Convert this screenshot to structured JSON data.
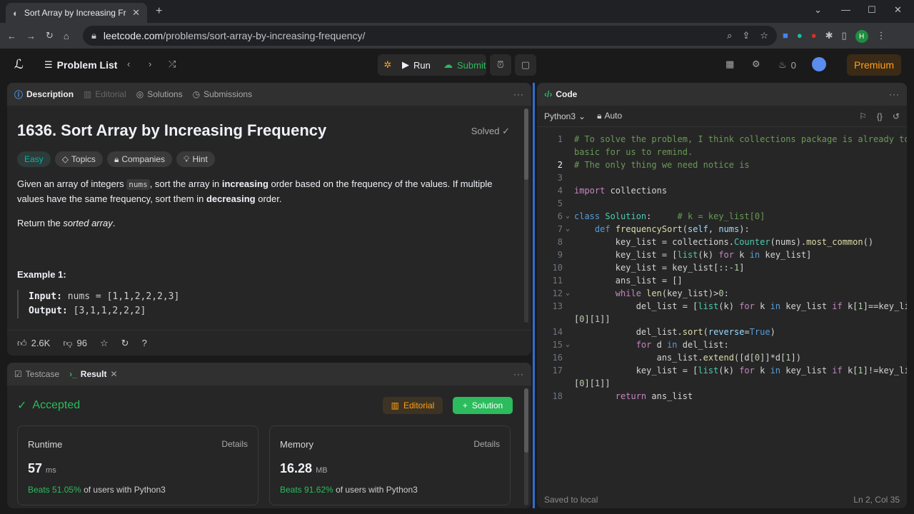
{
  "browser": {
    "tab_title": "Sort Array by Increasing Frequ...",
    "url_host": "leetcode.com",
    "url_path": "/problems/sort-array-by-increasing-frequency/",
    "profile_initial": "H"
  },
  "header": {
    "problem_list": "Problem List",
    "run": "Run",
    "submit": "Submit",
    "streak": "0",
    "premium": "Premium"
  },
  "description": {
    "tabs": [
      "Description",
      "Editorial",
      "Solutions",
      "Submissions"
    ],
    "title": "1636. Sort Array by Increasing Frequency",
    "status": "Solved",
    "tags": [
      "Easy",
      "Topics",
      "Companies",
      "Hint"
    ],
    "para1_a": "Given an array of integers ",
    "para1_code": "nums",
    "para1_b": ", sort the array in ",
    "para1_bold1": "increasing",
    "para1_c": " order based on the frequency of the values. If multiple values have the same frequency, sort them in ",
    "para1_bold2": "decreasing",
    "para1_d": " order.",
    "para2_a": "Return the ",
    "para2_em": "sorted array",
    "para2_b": ".",
    "example_title": "Example 1:",
    "input_label": "Input:",
    "input_value": "nums = [1,1,2,2,2,3]",
    "output_label": "Output:",
    "output_value": "[3,1,1,2,2,2]",
    "likes": "2.6K",
    "dislikes": "96"
  },
  "result": {
    "tabs": [
      "Testcase",
      "Result"
    ],
    "status": "Accepted",
    "editorial": "Editorial",
    "solution": "Solution",
    "runtime_label": "Runtime",
    "runtime_value": "57",
    "runtime_unit": "ms",
    "runtime_beats": "Beats 51.05%",
    "memory_label": "Memory",
    "memory_value": "16.28",
    "memory_unit": "MB",
    "memory_beats": "Beats 91.62%",
    "details": "Details",
    "beats_suffix": "of users with Python3"
  },
  "code": {
    "title": "Code",
    "language": "Python3",
    "mode": "Auto",
    "saved": "Saved to local",
    "cursor": "Ln 2, Col 35"
  },
  "colors": {
    "accent_green": "#2cbb5d",
    "accent_orange": "#ffa116",
    "divider_blue": "#2e6fd1"
  }
}
